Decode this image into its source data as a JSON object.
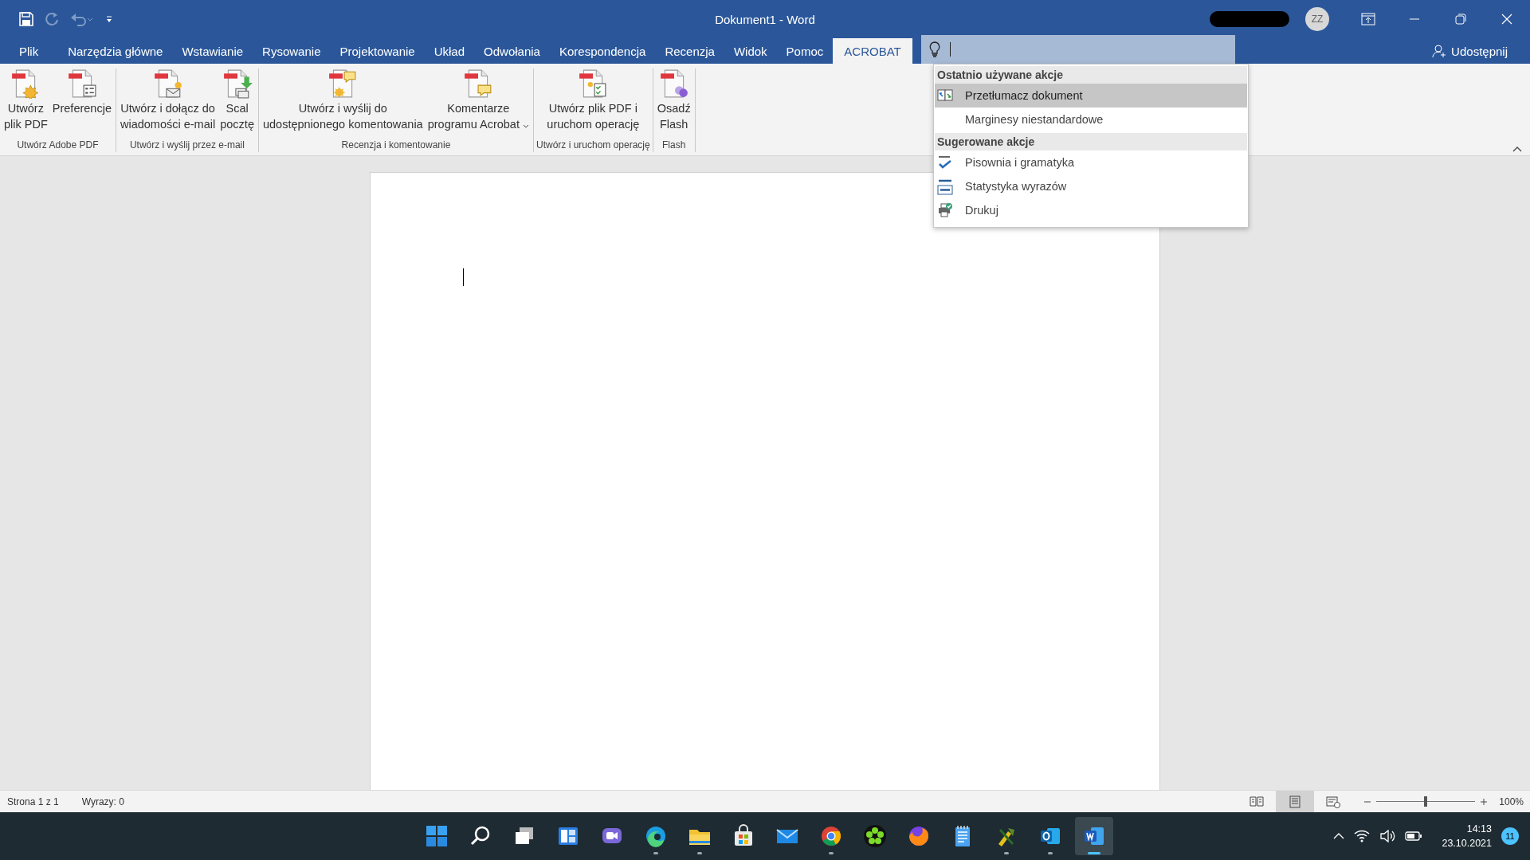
{
  "title_bar": {
    "title": "Dokument1 - Word",
    "avatar": "ZZ"
  },
  "tabs": [
    {
      "label": "Plik",
      "selected": false
    },
    {
      "label": "Narzędzia główne",
      "selected": false
    },
    {
      "label": "Wstawianie",
      "selected": false
    },
    {
      "label": "Rysowanie",
      "selected": false
    },
    {
      "label": "Projektowanie",
      "selected": false
    },
    {
      "label": "Układ",
      "selected": false
    },
    {
      "label": "Odwołania",
      "selected": false
    },
    {
      "label": "Korespondencja",
      "selected": false
    },
    {
      "label": "Recenzja",
      "selected": false
    },
    {
      "label": "Widok",
      "selected": false
    },
    {
      "label": "Pomoc",
      "selected": false
    },
    {
      "label": "ACROBAT",
      "selected": true
    }
  ],
  "tell_me": {
    "sections": [
      {
        "heading": "Ostatnio używane akcje",
        "items": [
          {
            "label": "Przetłumacz dokument",
            "kind": "translate",
            "selected": true
          },
          {
            "label": "Marginesy niestandardowe",
            "kind": "none",
            "selected": false
          }
        ]
      },
      {
        "heading": "Sugerowane akcje",
        "items": [
          {
            "label": "Pisownia i gramatyka",
            "kind": "spelling",
            "selected": false
          },
          {
            "label": "Statystyka wyrazów",
            "kind": "wordcount",
            "selected": false
          },
          {
            "label": "Drukuj",
            "kind": "print",
            "selected": false
          }
        ]
      }
    ]
  },
  "share": "Udostępnij",
  "ribbon": {
    "groups": [
      {
        "label": "Utwórz Adobe PDF",
        "buttons": [
          {
            "label": "Utwórz\nplik PDF",
            "kind": "star",
            "dropdown": false
          },
          {
            "label": "Preferencje",
            "kind": "list",
            "dropdown": false
          }
        ]
      },
      {
        "label": "Utwórz i wyślij przez e-mail",
        "buttons": [
          {
            "label": "Utwórz i dołącz do\nwiadomości e-mail",
            "kind": "mail",
            "dropdown": false
          },
          {
            "label": "Scal\npocztę",
            "kind": "merge",
            "dropdown": false
          }
        ]
      },
      {
        "label": "Recenzja i komentowanie",
        "buttons": [
          {
            "label": "Utwórz i wyślij do\nudostępnionego komentowania",
            "kind": "comment-star",
            "dropdown": false
          },
          {
            "label": "Komentarze\nprogramu Acrobat",
            "kind": "comment",
            "dropdown": true
          }
        ]
      },
      {
        "label": "Utwórz i uruchom operację",
        "buttons": [
          {
            "label": "Utwórz plik PDF i\nuruchom operację",
            "kind": "check",
            "dropdown": false
          }
        ]
      },
      {
        "label": "Flash",
        "buttons": [
          {
            "label": "Osadź\nFlash",
            "kind": "flash",
            "dropdown": false
          }
        ]
      }
    ]
  },
  "status_bar": {
    "page": "Strona 1 z 1",
    "words": "Wyrazy: 0",
    "views": [
      {
        "kind": "read",
        "selected": false
      },
      {
        "kind": "print",
        "selected": true
      },
      {
        "kind": "web",
        "selected": false
      }
    ],
    "zoom": {
      "level": 0.5,
      "label": "100%"
    }
  },
  "taskbar": {
    "apps": [
      {
        "kind": "start",
        "running": false,
        "active": false
      },
      {
        "kind": "search",
        "running": false,
        "active": false
      },
      {
        "kind": "taskview",
        "running": false,
        "active": false
      },
      {
        "kind": "widgets",
        "running": false,
        "active": false
      },
      {
        "kind": "chat",
        "running": false,
        "active": false
      },
      {
        "kind": "edge",
        "running": true,
        "active": false
      },
      {
        "kind": "folder",
        "running": true,
        "active": false
      },
      {
        "kind": "store",
        "running": false,
        "active": false
      },
      {
        "kind": "mail",
        "running": false,
        "active": false
      },
      {
        "kind": "chrome",
        "running": true,
        "active": false
      },
      {
        "kind": "flower",
        "running": false,
        "active": false
      },
      {
        "kind": "firefox",
        "running": false,
        "active": false
      },
      {
        "kind": "notepad",
        "running": false,
        "active": false
      },
      {
        "kind": "tool",
        "running": true,
        "active": false
      },
      {
        "kind": "outlook",
        "running": true,
        "active": false
      },
      {
        "kind": "word",
        "running": true,
        "active": true
      }
    ],
    "clock": {
      "time": "14:13",
      "date": "23.10.2021"
    },
    "notifications": "11"
  }
}
